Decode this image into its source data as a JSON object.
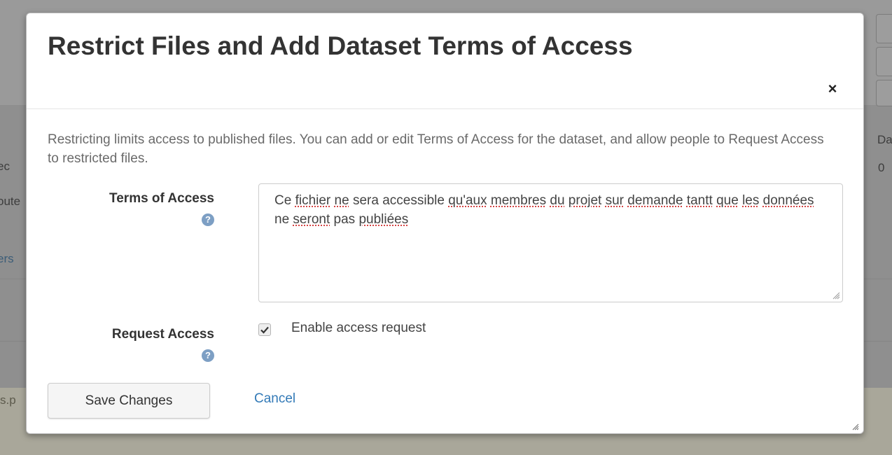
{
  "background": {
    "fragments_left": [
      "ec",
      "oute",
      "ers",
      "s.p"
    ],
    "fragments_right": [
      "Da",
      "0"
    ]
  },
  "modal": {
    "title": "Restrict Files and Add Dataset Terms of Access",
    "close_symbol": "×",
    "intro": "Restricting limits access to published files. You can add or edit Terms of Access for the dataset, and allow people to Request Access to restricted files.",
    "terms": {
      "label": "Terms of Access",
      "value_words": [
        "Ce",
        "fichier",
        "ne",
        "sera",
        "accessible",
        "qu'aux",
        "membres",
        "du",
        "projet",
        "sur",
        "demande",
        "tantt",
        "que",
        "les",
        "données",
        "ne",
        "seront",
        "pas",
        "publiées"
      ],
      "misspelled": [
        "fichier",
        "ne",
        "qu'aux",
        "membres",
        "du",
        "projet",
        "sur",
        "demande",
        "tantt",
        "que",
        "les",
        "données",
        "seront",
        "publiées"
      ]
    },
    "request_access": {
      "label": "Request Access",
      "checkbox_label": "Enable access request",
      "checked": true
    },
    "save_label": "Save Changes",
    "cancel_label": "Cancel"
  },
  "icons": {
    "help": "question-circle-icon",
    "close": "close-icon",
    "check": "checkmark-icon",
    "resize": "resize-grip-icon"
  },
  "colors": {
    "link": "#337ab7",
    "help_icon": "#7d9fc4",
    "title": "#333333"
  }
}
